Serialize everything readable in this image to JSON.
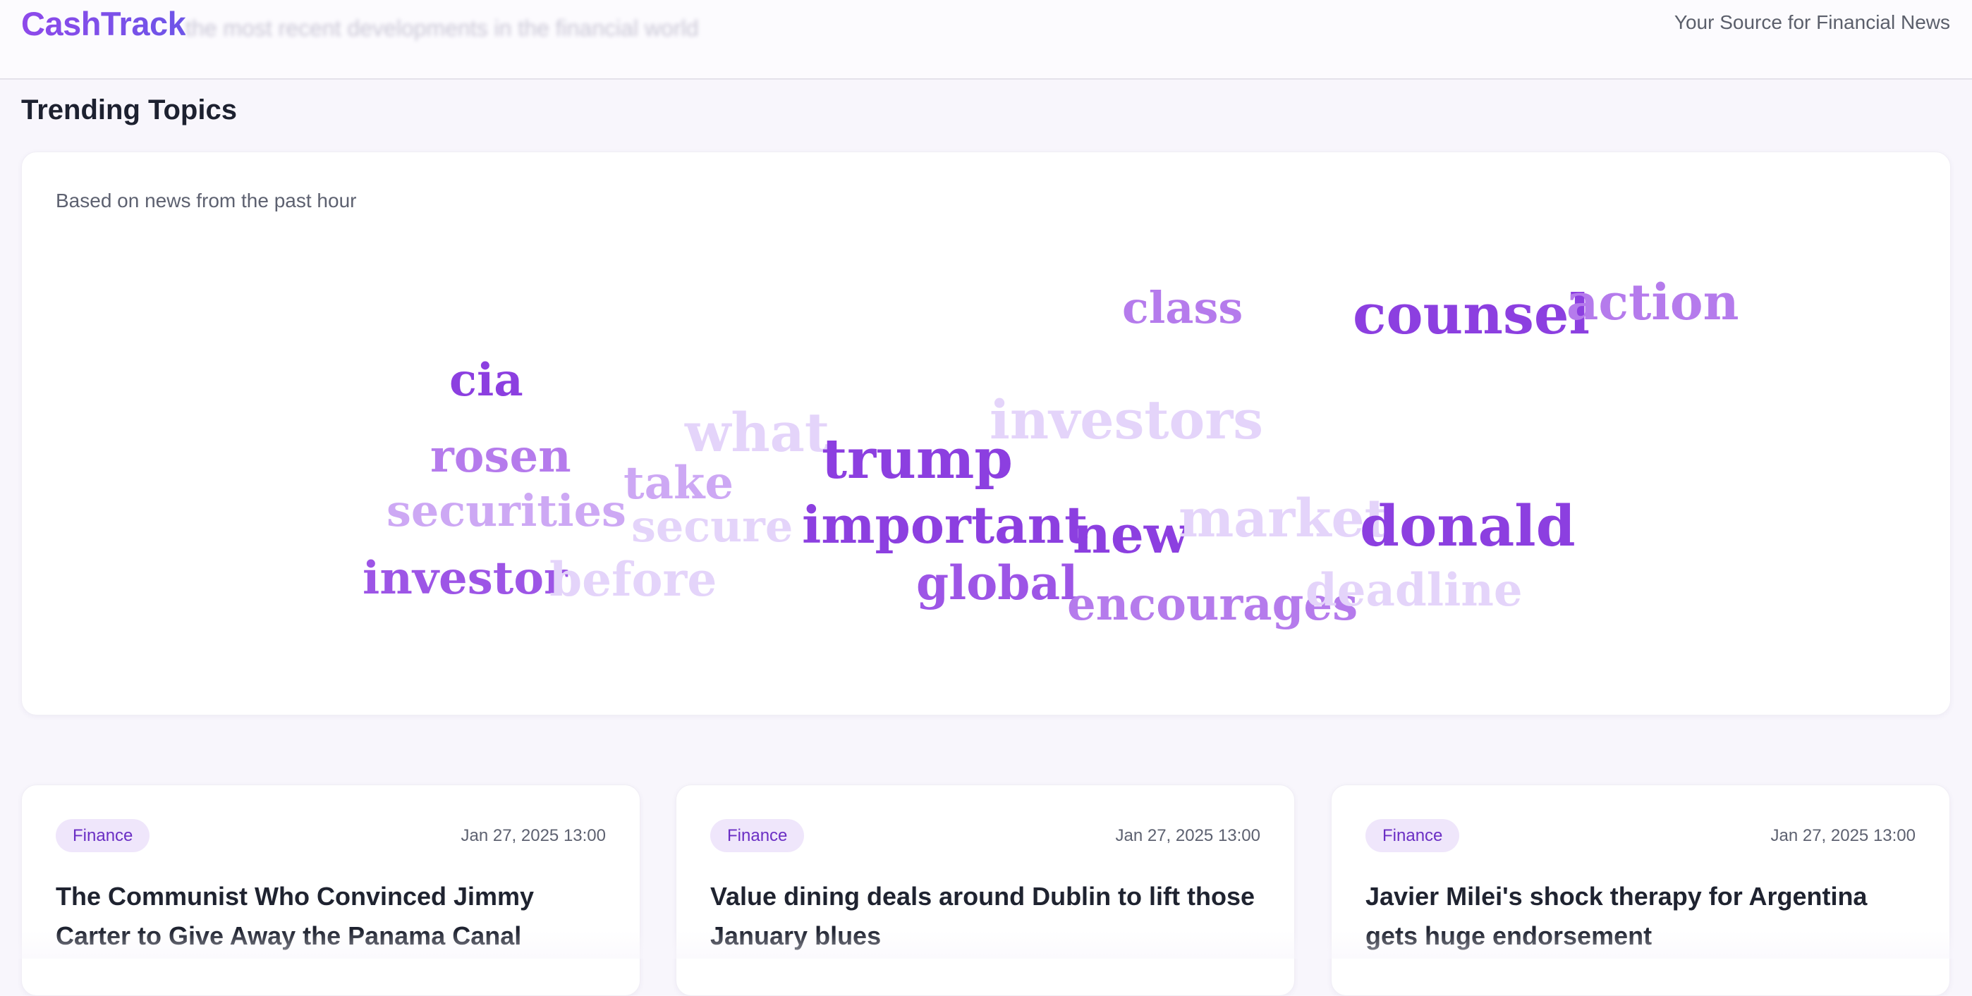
{
  "header": {
    "brand": "CashTrack",
    "subtitle": "the most recent developments in the financial world",
    "tagline": "Your Source for Financial News",
    "brand_gradient": [
      "#8e49ea",
      "#6d55e8"
    ]
  },
  "trending": {
    "title": "Trending Topics",
    "caption": "Based on news from the past hour",
    "words": [
      {
        "text": "class",
        "color": "#b57bec"
      },
      {
        "text": "counsel",
        "color": "#8c3fe0"
      },
      {
        "text": "action",
        "color": "#b57bec"
      },
      {
        "text": "cia",
        "color": "#8c3fe0"
      },
      {
        "text": "what",
        "color": "#e4d4fa"
      },
      {
        "text": "investors",
        "color": "#e4d4fa"
      },
      {
        "text": "trump",
        "color": "#8c3fe0"
      },
      {
        "text": "rosen",
        "color": "#b57bec"
      },
      {
        "text": "take",
        "color": "#cda8f4"
      },
      {
        "text": "securities",
        "color": "#cda8f4"
      },
      {
        "text": "secure",
        "color": "#e4d4fa"
      },
      {
        "text": "important",
        "color": "#8c3fe0"
      },
      {
        "text": "new",
        "color": "#8c3fe0"
      },
      {
        "text": "market",
        "color": "#e4d4fa"
      },
      {
        "text": "donald",
        "color": "#8c3fe0"
      },
      {
        "text": "investor",
        "color": "#9d55e6"
      },
      {
        "text": "before",
        "color": "#e4d4fa"
      },
      {
        "text": "global",
        "color": "#9d55e6"
      },
      {
        "text": "encourages",
        "color": "#b57bec"
      },
      {
        "text": "deadline",
        "color": "#e4d4fa"
      }
    ]
  },
  "news": [
    {
      "category": "Finance",
      "date": "Jan 27, 2025 13:00",
      "title": "The Communist Who Convinced Jimmy Carter to Give Away the Panama Canal"
    },
    {
      "category": "Finance",
      "date": "Jan 27, 2025 13:00",
      "title": "Value dining deals around Dublin to lift those January blues"
    },
    {
      "category": "Finance",
      "date": "Jan 27, 2025 13:00",
      "title": "Javier Milei's shock therapy for Argentina gets huge endorsement"
    }
  ]
}
